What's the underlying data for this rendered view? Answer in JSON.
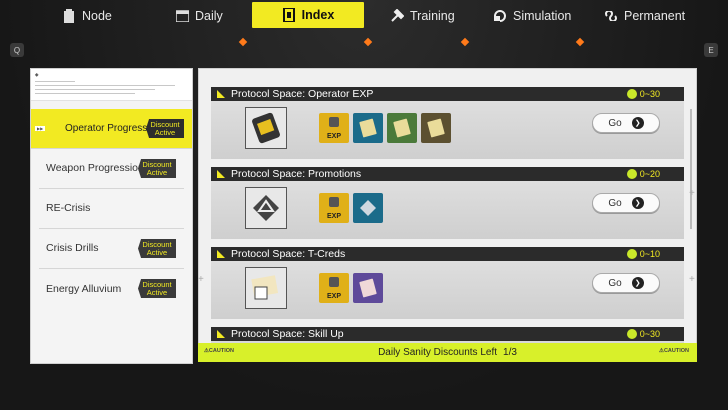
{
  "tabs": [
    {
      "label": "Node",
      "icon": "clipboard-icon",
      "active": false
    },
    {
      "label": "Daily",
      "icon": "calendar-icon",
      "active": false
    },
    {
      "label": "Index",
      "icon": "index-icon",
      "active": true
    },
    {
      "label": "Training",
      "icon": "hammer-icon",
      "active": false
    },
    {
      "label": "Simulation",
      "icon": "simulation-icon",
      "active": false
    },
    {
      "label": "Permanent",
      "icon": "infinity-icon",
      "active": false
    }
  ],
  "key_hints": {
    "left": "Q",
    "right": "E"
  },
  "categories": [
    {
      "label": "Operator Progression",
      "discount": "Discount Active",
      "active": true
    },
    {
      "label": "Weapon Progression",
      "discount": "Discount Active",
      "active": false
    },
    {
      "label": "RE-Crisis",
      "discount": "",
      "active": false
    },
    {
      "label": "Crisis Drills",
      "discount": "Discount Active",
      "active": false
    },
    {
      "label": "Energy Alluvium",
      "discount": "Discount Active",
      "active": false
    }
  ],
  "protocols": [
    {
      "title": "Protocol Space: Operator EXP",
      "sanity": "0~30",
      "go": "Go",
      "drops": [
        "exp",
        "blue",
        "green",
        "brown"
      ]
    },
    {
      "title": "Protocol Space: Promotions",
      "sanity": "0~20",
      "go": "Go",
      "drops": [
        "exp",
        "blue"
      ]
    },
    {
      "title": "Protocol Space: T-Creds",
      "sanity": "0~10",
      "go": "Go",
      "drops": [
        "exp",
        "purple"
      ]
    },
    {
      "title": "Protocol Space: Skill Up",
      "sanity": "0~30",
      "go": "Go",
      "drops": []
    }
  ],
  "footer": {
    "label": "Daily Sanity Discounts Left",
    "value": "1/3",
    "caution": "⚠CAUTION"
  },
  "colors": {
    "accent": "#f2ea22",
    "footer": "#d8f02a",
    "marker": "#ff7a1a"
  }
}
